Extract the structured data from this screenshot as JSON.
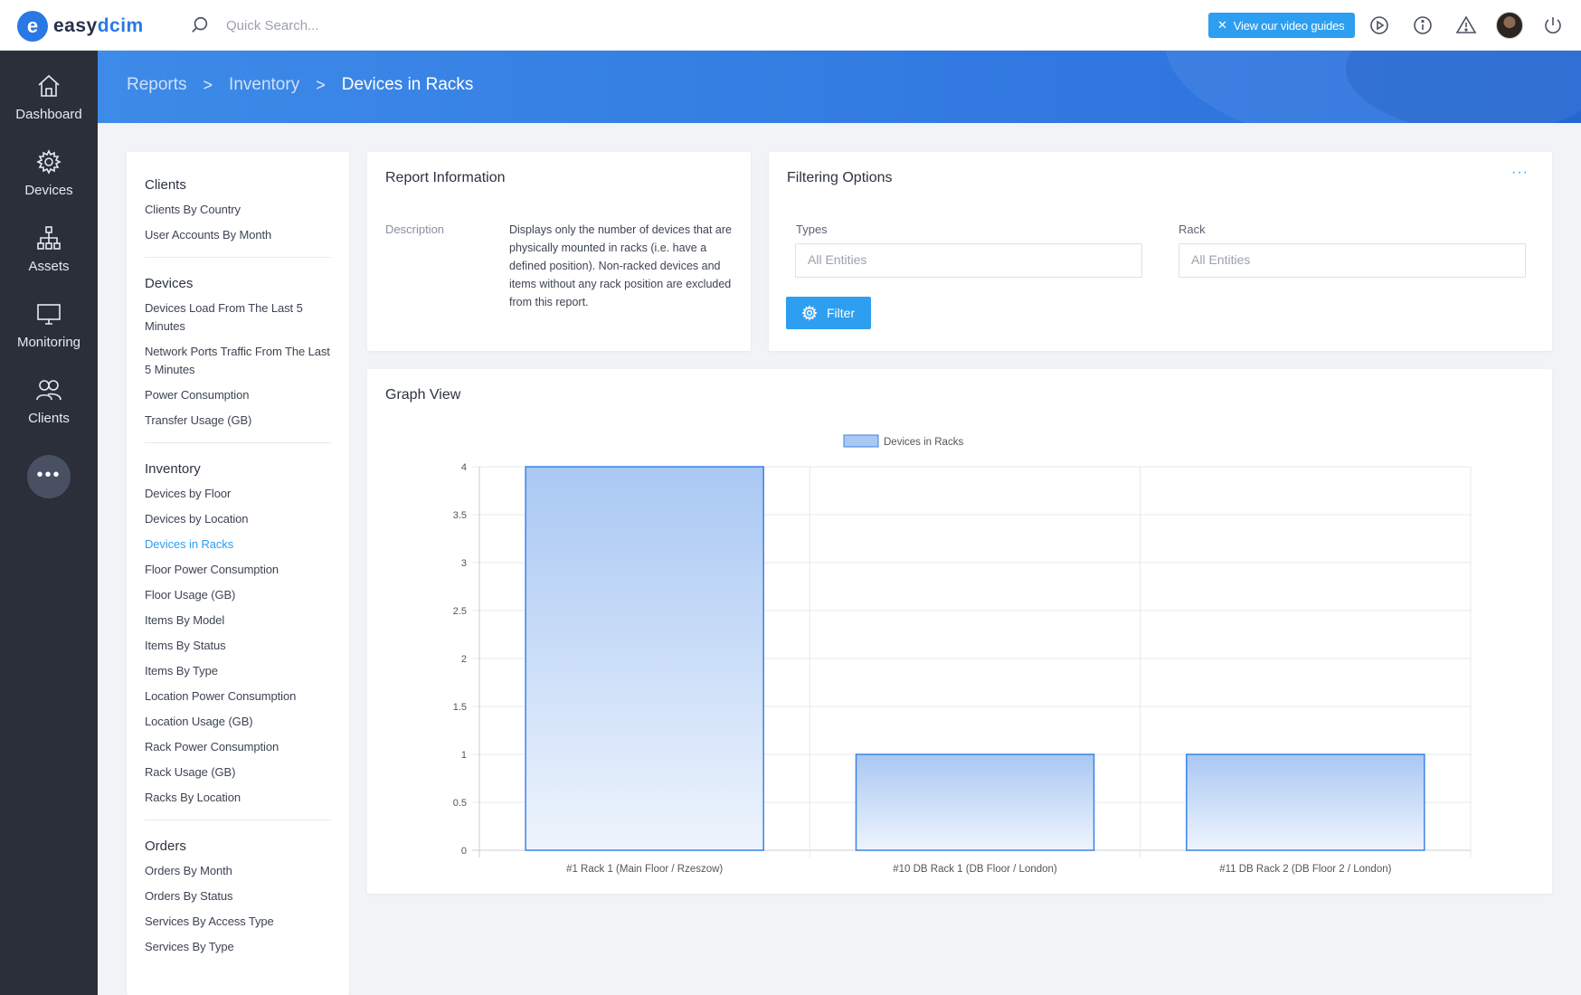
{
  "app": {
    "logo_letter": "e",
    "logo_text_prefix": "easy",
    "logo_text_suffix": "dcim",
    "brand_color": "#2a78e4",
    "accent_color": "#2d9ef0"
  },
  "topbar": {
    "search_placeholder": "Quick Search...",
    "video_guides_label": "View our video guides",
    "icons": [
      "search-icon",
      "close-icon",
      "play-icon",
      "info-icon",
      "warning-icon",
      "avatar",
      "power-icon"
    ]
  },
  "sidebar": {
    "items": [
      {
        "label": "Dashboard",
        "icon": "home-icon"
      },
      {
        "label": "Devices",
        "icon": "gear-icon"
      },
      {
        "label": "Assets",
        "icon": "hierarchy-icon"
      },
      {
        "label": "Monitoring",
        "icon": "monitor-icon"
      },
      {
        "label": "Clients",
        "icon": "users-icon"
      }
    ],
    "more_label": "•••"
  },
  "breadcrumb": {
    "items": [
      "Reports",
      "Inventory",
      "Devices in Racks"
    ],
    "separator": ">"
  },
  "report_menu": {
    "groups": [
      {
        "title": "Clients",
        "links": [
          "Clients By Country",
          "User Accounts By Month"
        ]
      },
      {
        "title": "Devices",
        "links": [
          "Devices Load From The Last 5 Minutes",
          "Network Ports Traffic From The Last 5 Minutes",
          "Power Consumption",
          "Transfer Usage (GB)"
        ]
      },
      {
        "title": "Inventory",
        "links": [
          "Devices by Floor",
          "Devices by Location",
          "Devices in Racks",
          "Floor Power Consumption",
          "Floor Usage (GB)",
          "Items By Model",
          "Items By Status",
          "Items By Type",
          "Location Power Consumption",
          "Location Usage (GB)",
          "Rack Power Consumption",
          "Rack Usage (GB)",
          "Racks By Location"
        ]
      },
      {
        "title": "Orders",
        "links": [
          "Orders By Month",
          "Orders By Status",
          "Services By Access Type",
          "Services By Type"
        ]
      }
    ],
    "active_link": "Devices in Racks"
  },
  "report_info": {
    "title": "Report Information",
    "description_label": "Description",
    "description_text": "Displays only the number of devices that are physically mounted in racks (i.e. have a defined position). Non-racked devices and items without any rack position are excluded from this report."
  },
  "filter": {
    "title": "Filtering Options",
    "more_label": "···",
    "types_label": "Types",
    "types_value": "All Entities",
    "rack_label": "Rack",
    "rack_value": "All Entities",
    "button_label": "Filter"
  },
  "graph": {
    "title": "Graph View"
  },
  "chart_data": {
    "type": "bar",
    "title": "",
    "xlabel": "",
    "ylabel": "",
    "categories": [
      "#1 Rack 1 (Main Floor / Rzeszow)",
      "#10 DB Rack 1 (DB Floor / London)",
      "#11 DB Rack 2 (DB Floor 2 / London)"
    ],
    "series": [
      {
        "name": "Devices in Racks",
        "values": [
          4,
          1,
          1
        ],
        "color": "#a9c8f3",
        "border": "#3b82e6"
      }
    ],
    "ylim": [
      0,
      4
    ],
    "yticks": [
      "0",
      "0.5",
      "1",
      "1.5",
      "2",
      "2.5",
      "3",
      "3.5",
      "4"
    ],
    "grid": true,
    "legend": "top-center"
  }
}
